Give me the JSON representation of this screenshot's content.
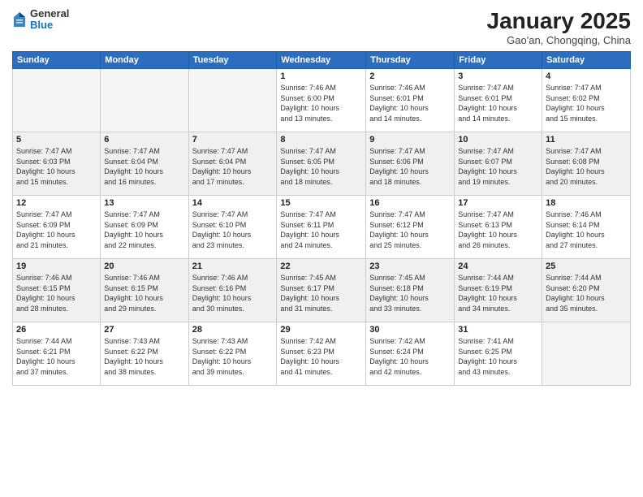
{
  "header": {
    "logo_general": "General",
    "logo_blue": "Blue",
    "title": "January 2025",
    "subtitle": "Gao'an, Chongqing, China"
  },
  "weekdays": [
    "Sunday",
    "Monday",
    "Tuesday",
    "Wednesday",
    "Thursday",
    "Friday",
    "Saturday"
  ],
  "weeks": [
    {
      "shaded": false,
      "days": [
        {
          "num": "",
          "info": ""
        },
        {
          "num": "",
          "info": ""
        },
        {
          "num": "",
          "info": ""
        },
        {
          "num": "1",
          "info": "Sunrise: 7:46 AM\nSunset: 6:00 PM\nDaylight: 10 hours\nand 13 minutes."
        },
        {
          "num": "2",
          "info": "Sunrise: 7:46 AM\nSunset: 6:01 PM\nDaylight: 10 hours\nand 14 minutes."
        },
        {
          "num": "3",
          "info": "Sunrise: 7:47 AM\nSunset: 6:01 PM\nDaylight: 10 hours\nand 14 minutes."
        },
        {
          "num": "4",
          "info": "Sunrise: 7:47 AM\nSunset: 6:02 PM\nDaylight: 10 hours\nand 15 minutes."
        }
      ]
    },
    {
      "shaded": true,
      "days": [
        {
          "num": "5",
          "info": "Sunrise: 7:47 AM\nSunset: 6:03 PM\nDaylight: 10 hours\nand 15 minutes."
        },
        {
          "num": "6",
          "info": "Sunrise: 7:47 AM\nSunset: 6:04 PM\nDaylight: 10 hours\nand 16 minutes."
        },
        {
          "num": "7",
          "info": "Sunrise: 7:47 AM\nSunset: 6:04 PM\nDaylight: 10 hours\nand 17 minutes."
        },
        {
          "num": "8",
          "info": "Sunrise: 7:47 AM\nSunset: 6:05 PM\nDaylight: 10 hours\nand 18 minutes."
        },
        {
          "num": "9",
          "info": "Sunrise: 7:47 AM\nSunset: 6:06 PM\nDaylight: 10 hours\nand 18 minutes."
        },
        {
          "num": "10",
          "info": "Sunrise: 7:47 AM\nSunset: 6:07 PM\nDaylight: 10 hours\nand 19 minutes."
        },
        {
          "num": "11",
          "info": "Sunrise: 7:47 AM\nSunset: 6:08 PM\nDaylight: 10 hours\nand 20 minutes."
        }
      ]
    },
    {
      "shaded": false,
      "days": [
        {
          "num": "12",
          "info": "Sunrise: 7:47 AM\nSunset: 6:09 PM\nDaylight: 10 hours\nand 21 minutes."
        },
        {
          "num": "13",
          "info": "Sunrise: 7:47 AM\nSunset: 6:09 PM\nDaylight: 10 hours\nand 22 minutes."
        },
        {
          "num": "14",
          "info": "Sunrise: 7:47 AM\nSunset: 6:10 PM\nDaylight: 10 hours\nand 23 minutes."
        },
        {
          "num": "15",
          "info": "Sunrise: 7:47 AM\nSunset: 6:11 PM\nDaylight: 10 hours\nand 24 minutes."
        },
        {
          "num": "16",
          "info": "Sunrise: 7:47 AM\nSunset: 6:12 PM\nDaylight: 10 hours\nand 25 minutes."
        },
        {
          "num": "17",
          "info": "Sunrise: 7:47 AM\nSunset: 6:13 PM\nDaylight: 10 hours\nand 26 minutes."
        },
        {
          "num": "18",
          "info": "Sunrise: 7:46 AM\nSunset: 6:14 PM\nDaylight: 10 hours\nand 27 minutes."
        }
      ]
    },
    {
      "shaded": true,
      "days": [
        {
          "num": "19",
          "info": "Sunrise: 7:46 AM\nSunset: 6:15 PM\nDaylight: 10 hours\nand 28 minutes."
        },
        {
          "num": "20",
          "info": "Sunrise: 7:46 AM\nSunset: 6:15 PM\nDaylight: 10 hours\nand 29 minutes."
        },
        {
          "num": "21",
          "info": "Sunrise: 7:46 AM\nSunset: 6:16 PM\nDaylight: 10 hours\nand 30 minutes."
        },
        {
          "num": "22",
          "info": "Sunrise: 7:45 AM\nSunset: 6:17 PM\nDaylight: 10 hours\nand 31 minutes."
        },
        {
          "num": "23",
          "info": "Sunrise: 7:45 AM\nSunset: 6:18 PM\nDaylight: 10 hours\nand 33 minutes."
        },
        {
          "num": "24",
          "info": "Sunrise: 7:44 AM\nSunset: 6:19 PM\nDaylight: 10 hours\nand 34 minutes."
        },
        {
          "num": "25",
          "info": "Sunrise: 7:44 AM\nSunset: 6:20 PM\nDaylight: 10 hours\nand 35 minutes."
        }
      ]
    },
    {
      "shaded": false,
      "days": [
        {
          "num": "26",
          "info": "Sunrise: 7:44 AM\nSunset: 6:21 PM\nDaylight: 10 hours\nand 37 minutes."
        },
        {
          "num": "27",
          "info": "Sunrise: 7:43 AM\nSunset: 6:22 PM\nDaylight: 10 hours\nand 38 minutes."
        },
        {
          "num": "28",
          "info": "Sunrise: 7:43 AM\nSunset: 6:22 PM\nDaylight: 10 hours\nand 39 minutes."
        },
        {
          "num": "29",
          "info": "Sunrise: 7:42 AM\nSunset: 6:23 PM\nDaylight: 10 hours\nand 41 minutes."
        },
        {
          "num": "30",
          "info": "Sunrise: 7:42 AM\nSunset: 6:24 PM\nDaylight: 10 hours\nand 42 minutes."
        },
        {
          "num": "31",
          "info": "Sunrise: 7:41 AM\nSunset: 6:25 PM\nDaylight: 10 hours\nand 43 minutes."
        },
        {
          "num": "",
          "info": ""
        }
      ]
    }
  ]
}
